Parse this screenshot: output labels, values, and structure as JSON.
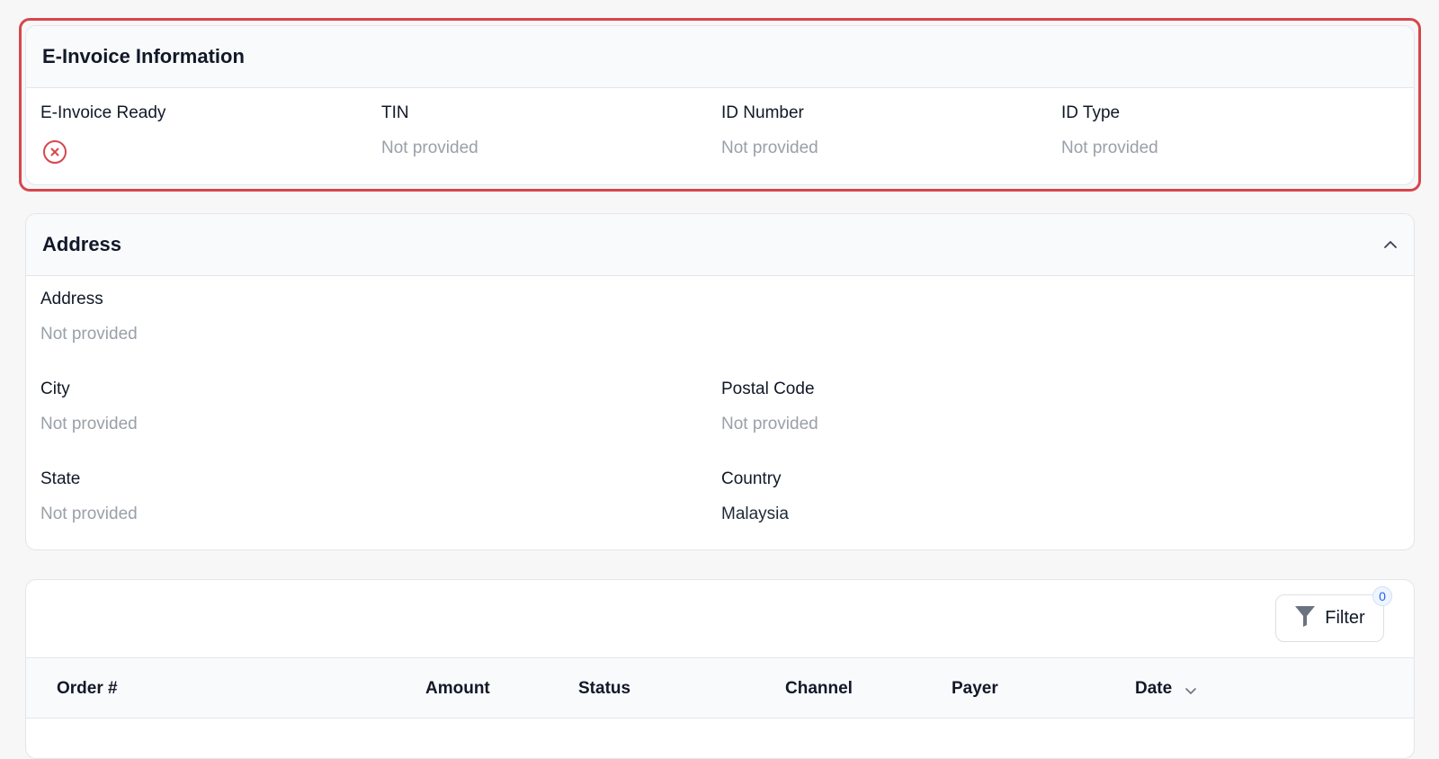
{
  "einvoice": {
    "title": "E-Invoice Information",
    "fields": [
      {
        "label": "E-Invoice Ready",
        "icon": "x-circle-icon"
      },
      {
        "label": "TIN",
        "value": "Not provided"
      },
      {
        "label": "ID Number",
        "value": "Not provided"
      },
      {
        "label": "ID Type",
        "value": "Not provided"
      }
    ]
  },
  "address": {
    "title": "Address",
    "fields": [
      {
        "label": "Address",
        "value": "Not provided"
      },
      {
        "label": "City",
        "value": "Not provided"
      },
      {
        "label": "Postal Code",
        "value": "Not provided"
      },
      {
        "label": "State",
        "value": "Not provided"
      },
      {
        "label": "Country",
        "value": "Malaysia"
      }
    ]
  },
  "orders": {
    "filter_label": "Filter",
    "filter_count": "0",
    "columns": [
      "Order #",
      "Amount",
      "Status",
      "Channel",
      "Payer",
      "Date"
    ]
  },
  "colors": {
    "highlight": "#d6464c",
    "error_icon": "#d6464c",
    "muted_text": "#9aa0a8",
    "badge_text": "#2563eb"
  }
}
